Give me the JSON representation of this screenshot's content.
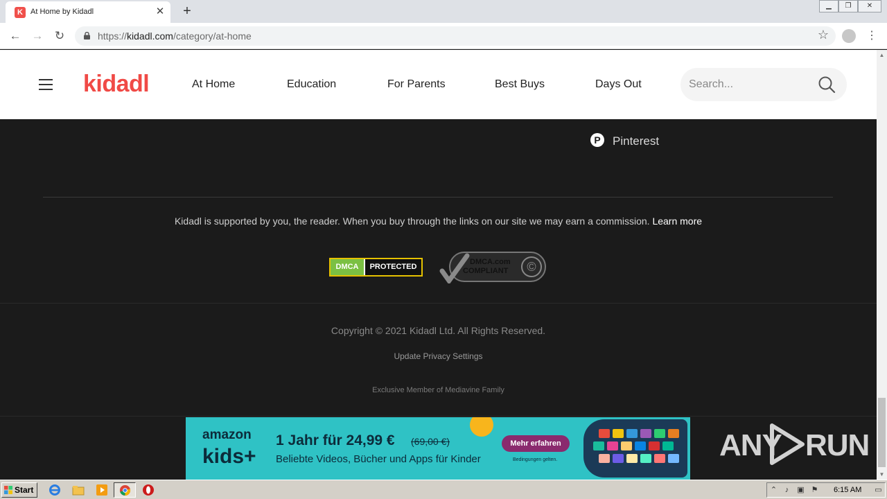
{
  "browser": {
    "tab_title": "At Home by Kidadl",
    "tab_favicon_letter": "K",
    "new_tab_icon": "plus-icon",
    "url_scheme": "https://",
    "url_host": "kidadl.com",
    "url_path": "/category/at-home"
  },
  "site": {
    "logo_text": "kidadl",
    "brand_color": "#f04a46",
    "nav": [
      {
        "label": "At Home"
      },
      {
        "label": "Education"
      },
      {
        "label": "For Parents"
      },
      {
        "label": "Best Buys"
      },
      {
        "label": "Days Out"
      }
    ],
    "search_placeholder": "Search..."
  },
  "footer": {
    "social_label": "Pinterest",
    "support_text": "Kidadl is supported by you, the reader. When you buy through the links on our site we may earn a commission.",
    "learn_more": "Learn more",
    "dmca_badge_left": "DMCA",
    "dmca_badge_right": "PROTECTED",
    "dmca_compliant_line1": "DMCA.com",
    "dmca_compliant_line2": "COMPLIANT",
    "copyright": "Copyright © 2021 Kidadl Ltd. All Rights Reserved.",
    "privacy_link": "Update Privacy Settings",
    "mediavine": "Exclusive Member of Mediavine Family"
  },
  "ad": {
    "brand_line1": "amazon",
    "brand_line2": "kids+",
    "headline": "1 Jahr für 24,99 €",
    "old_price": "(69,00 €)",
    "subline": "Beliebte Videos, Bücher und Apps für Kinder",
    "cta": "Mehr erfahren",
    "terms": "Bedingungen gelten."
  },
  "watermark": {
    "left": "ANY",
    "right": "RUN"
  },
  "taskbar": {
    "start_label": "Start",
    "clock": "6:15 AM"
  }
}
